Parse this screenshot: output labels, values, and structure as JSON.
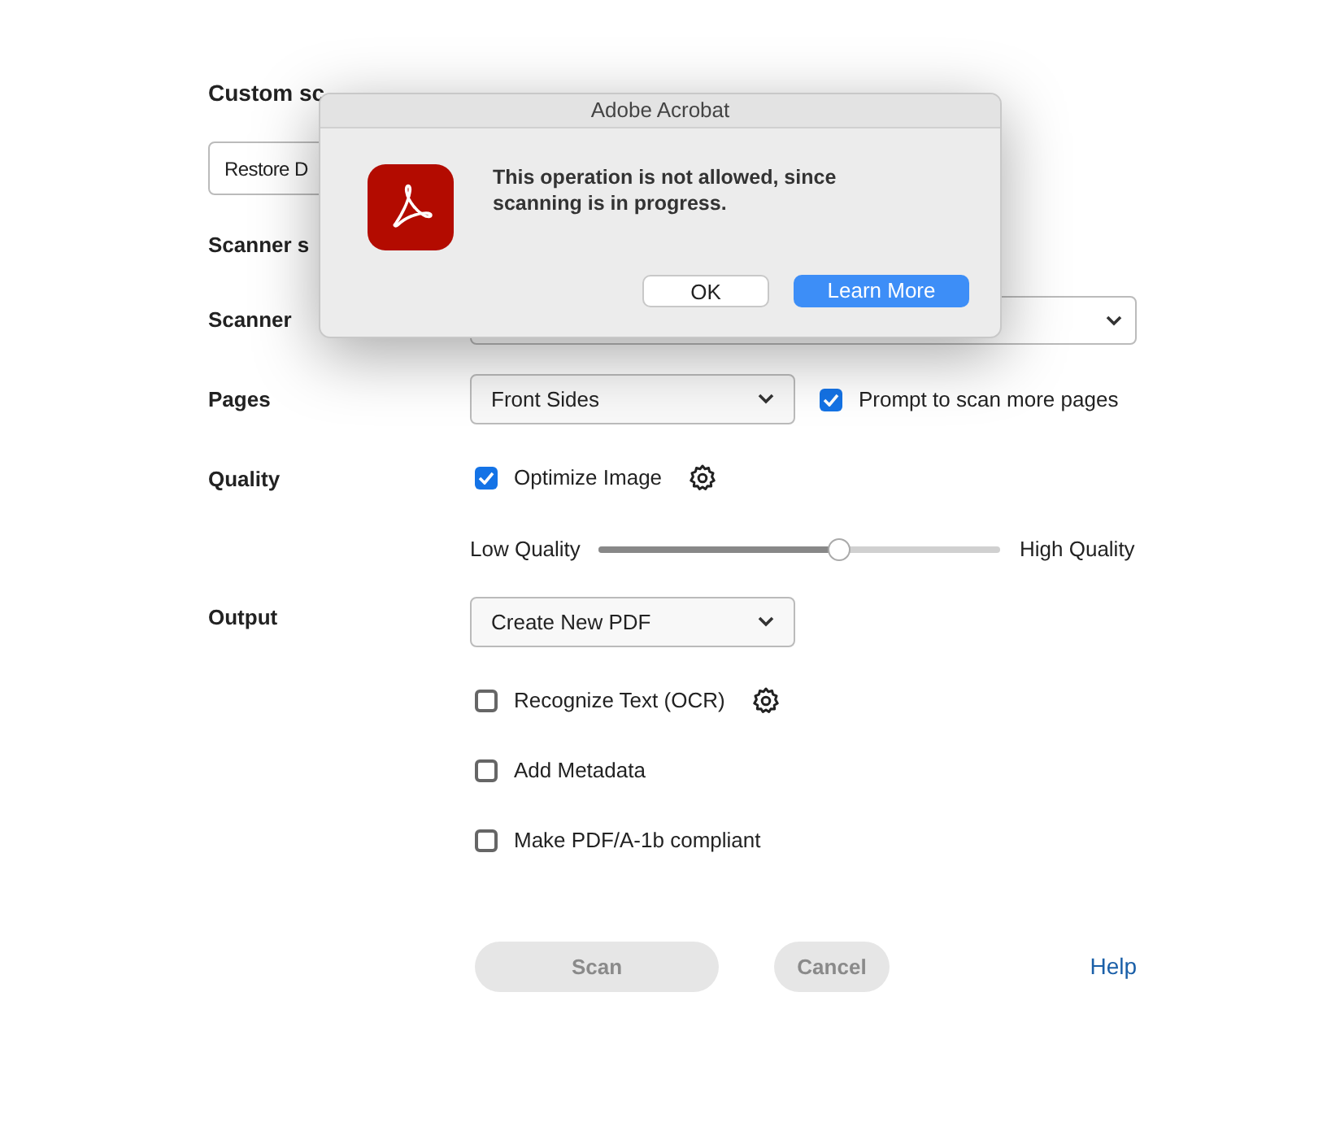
{
  "heading": "Custom sc",
  "restore_button": "Restore D",
  "section_heading": "Scanner s",
  "scanner": {
    "label": "Scanner"
  },
  "pages": {
    "label": "Pages",
    "value": "Front Sides",
    "prompt": {
      "label": "Prompt to scan more pages",
      "checked": true
    }
  },
  "quality": {
    "label": "Quality",
    "optimize": {
      "label": "Optimize Image",
      "checked": true,
      "settings": true
    },
    "low_label": "Low Quality",
    "high_label": "High Quality",
    "level": 0.6
  },
  "output": {
    "label": "Output",
    "value": "Create New PDF",
    "options": [
      {
        "label": "Recognize Text (OCR)",
        "checked": false,
        "settings": true
      },
      {
        "label": "Add Metadata",
        "checked": false,
        "settings": false
      },
      {
        "label": "Make PDF/A-1b compliant",
        "checked": false,
        "settings": false
      }
    ]
  },
  "actions": [
    {
      "label": "Scan",
      "disabled": true
    },
    {
      "label": "Cancel",
      "disabled": true
    }
  ],
  "help": "Help",
  "dialog": {
    "title": "Adobe Acrobat",
    "message": "This operation is not allowed, since scanning is in progress.",
    "buttons": [
      {
        "label": "OK",
        "default": false
      },
      {
        "label": "Learn More",
        "default": true
      }
    ]
  }
}
